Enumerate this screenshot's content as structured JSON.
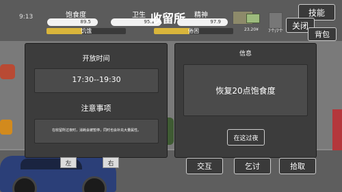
{
  "hud": {
    "time": "9:13",
    "title": "收留所",
    "stats": [
      {
        "label": "饱食度",
        "value": "89.5",
        "status": "饥饿",
        "level": 0.45
      },
      {
        "label": "卫生",
        "value": "95.1"
      },
      {
        "label": "精神",
        "value": "97.9",
        "status": "倦困",
        "level": 0.45
      }
    ],
    "money": "23.20¥",
    "days": "7个/7个"
  },
  "side_buttons": {
    "skill": "技能",
    "close": "关闭",
    "bag": "背包"
  },
  "left_panel": {
    "title": "开放时间",
    "hours": "17:30--19:30",
    "notice_title": "注意事项",
    "notice_text": "在收留所过夜时，消耗会被暂停，同时也会补充大量属性。"
  },
  "right_panel": {
    "title": "信息",
    "info": "恢复20点饱食度",
    "button": "在这过夜"
  },
  "bottom": {
    "left_label": "左",
    "right_label": "右",
    "interact": "交互",
    "beg": "乞讨",
    "pickup": "拾取"
  },
  "colors": {
    "panel": "#3c3c3c",
    "inner": "#4b4b4b",
    "status_fill": "#d9b53b",
    "stat_bar": "#f2f2f2"
  }
}
